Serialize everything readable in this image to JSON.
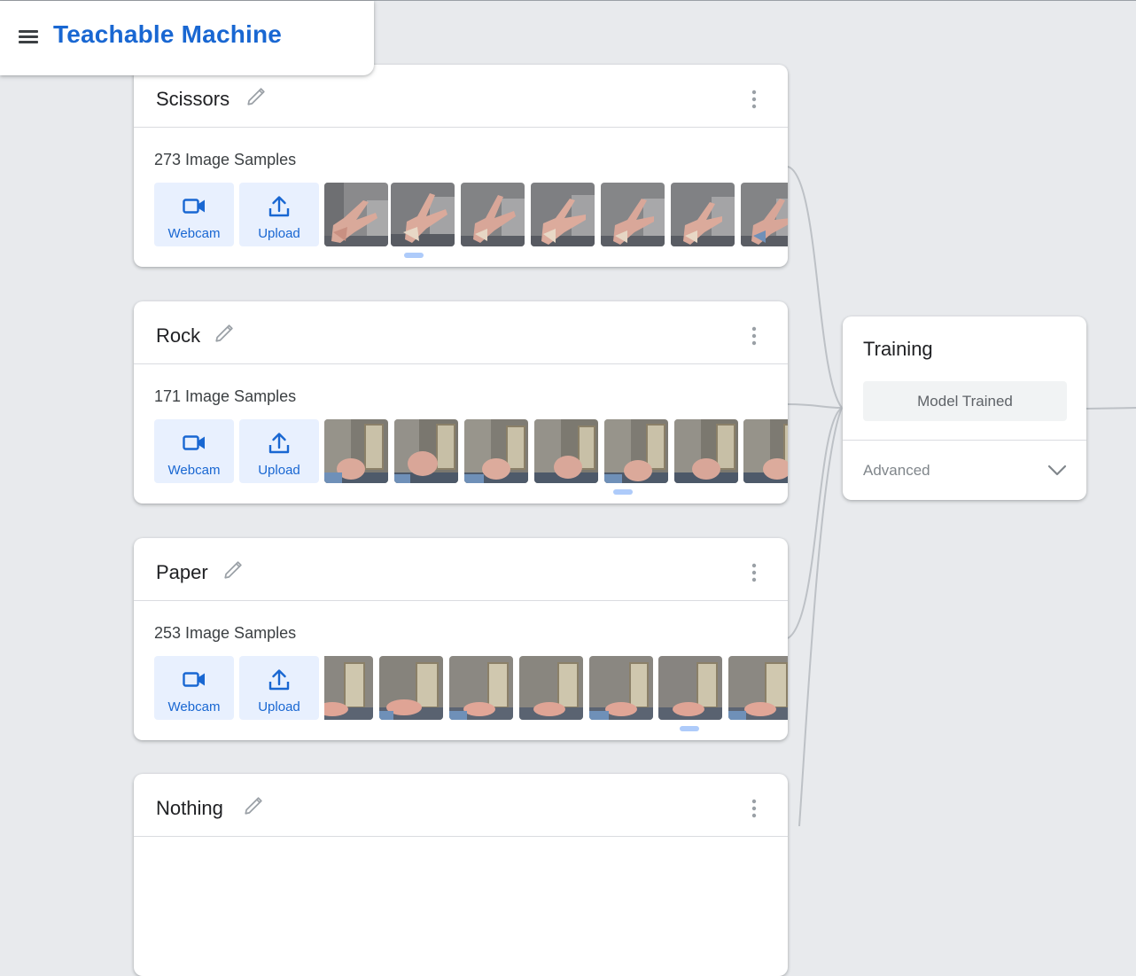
{
  "header": {
    "title": "Teachable Machine",
    "menu_icon": "hamburger-menu-icon"
  },
  "classes": [
    {
      "name": "Scissors",
      "count_label": "273 Image Samples",
      "webcam_label": "Webcam",
      "upload_label": "Upload",
      "thumb_count": 7,
      "scroll_position": 0.18
    },
    {
      "name": "Rock",
      "count_label": "171 Image Samples",
      "webcam_label": "Webcam",
      "upload_label": "Upload",
      "thumb_count": 7,
      "scroll_position": 0.65
    },
    {
      "name": "Paper",
      "count_label": "253 Image Samples",
      "webcam_label": "Webcam",
      "upload_label": "Upload",
      "thumb_count": 7,
      "scroll_position": 0.8
    },
    {
      "name": "Nothing"
    }
  ],
  "training": {
    "title": "Training",
    "button_label": "Model Trained",
    "advanced_label": "Advanced"
  },
  "colors": {
    "brand": "#1967d2",
    "button_bg": "#e8f0fe",
    "scroll_handle": "#aecbfa",
    "page_bg": "#e8eaed",
    "connector": "#bdc1c6"
  },
  "icons": [
    "hamburger-menu-icon",
    "pencil-edit-icon",
    "more-vert-icon",
    "videocam-icon",
    "upload-icon",
    "chevron-down-icon"
  ]
}
